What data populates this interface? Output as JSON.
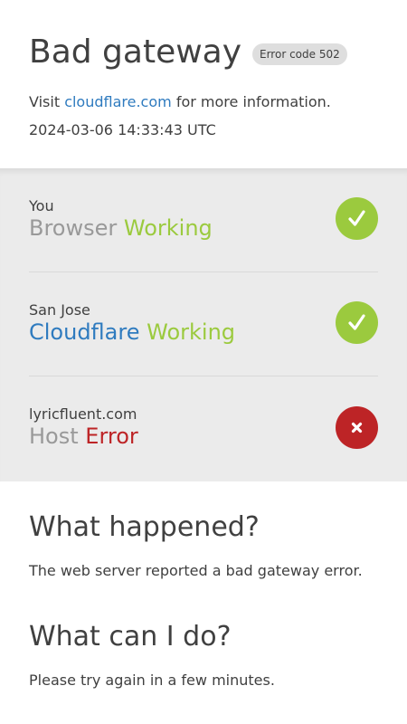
{
  "header": {
    "title": "Bad gateway",
    "error_badge": "Error code 502",
    "visit_prefix": "Visit",
    "visit_link": "cloudflare.com",
    "visit_suffix": "for more information.",
    "timestamp": "2024-03-06 14:33:43 UTC"
  },
  "status_rows": [
    {
      "location": "You",
      "name": "Browser",
      "status": "Working",
      "state": "ok",
      "icon": "check-icon"
    },
    {
      "location": "San Jose",
      "name": "Cloudflare",
      "status": "Working",
      "state": "ok",
      "icon": "check-icon"
    },
    {
      "location": "lyricfluent.com",
      "name": "Host",
      "status": "Error",
      "state": "error",
      "icon": "x-icon"
    }
  ],
  "what_happened": {
    "heading": "What happened?",
    "text": "The web server reported a bad gateway error."
  },
  "what_can_i_do": {
    "heading": "What can I do?",
    "text": "Please try again in a few minutes."
  },
  "colors": {
    "ok": "#9bca3e",
    "error": "#bd2426",
    "link": "#2f7bbf"
  }
}
